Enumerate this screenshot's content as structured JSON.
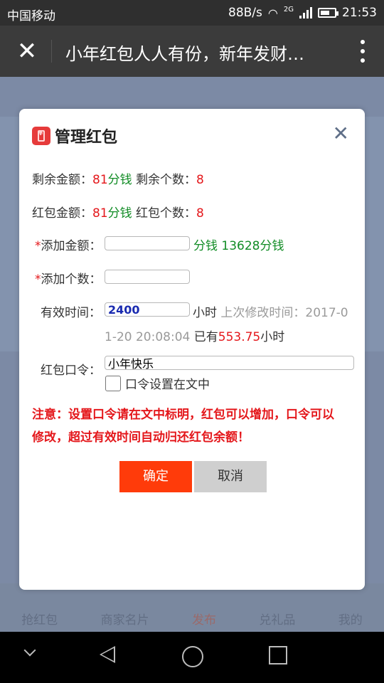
{
  "status_bar": {
    "carrier": "中国移动",
    "speed": "88B/s",
    "network": "2G",
    "battery_level": 0.6,
    "time": "21:53"
  },
  "title_bar": {
    "title": "小年红包人人有份，新年发财…"
  },
  "bottom_nav": {
    "tabs": [
      "抢红包",
      "商家名片",
      "发布",
      "兑礼品",
      "我的"
    ],
    "active": "发布"
  },
  "dialog": {
    "title": "管理红包",
    "remaining_amount_label": "剩余金额：",
    "remaining_amount": "81",
    "remaining_amount_unit": "分钱",
    "remaining_count_label": "剩余个数：",
    "remaining_count": "8",
    "total_amount_label": "红包金额：",
    "total_amount": "81",
    "total_amount_unit": "分钱",
    "total_count_label": "红包个数：",
    "total_count": "8",
    "add_amount_label": "添加金额：",
    "add_amount_value": "",
    "add_amount_unit": "分钱",
    "balance": "13628分钱",
    "add_count_label": "添加个数：",
    "add_count_value": "",
    "required_mark": "*",
    "valid_time_label": "有效时间：",
    "valid_time_value": "2400",
    "valid_time_unit": "小时",
    "last_modified_label": "上次修改时间：2017-0",
    "last_modified_cont": "1-20 20:08:04",
    "elapsed_prefix": "已有",
    "elapsed_value": "553.75",
    "elapsed_unit": "小时",
    "password_label": "红包口令：",
    "password_value": "小年快乐",
    "password_in_text_label": "口令设置在文中",
    "notice_line1": "注意：设置口令请在文中标明，红包可以增加，口令可以",
    "notice_line2": "修改，超过有效时间自动归还红包余额！",
    "confirm_label": "确定",
    "cancel_label": "取消"
  },
  "colors": {
    "accent_red": "#e4171b",
    "money_green": "#118c25",
    "confirm_button": "#ff3b0a"
  }
}
